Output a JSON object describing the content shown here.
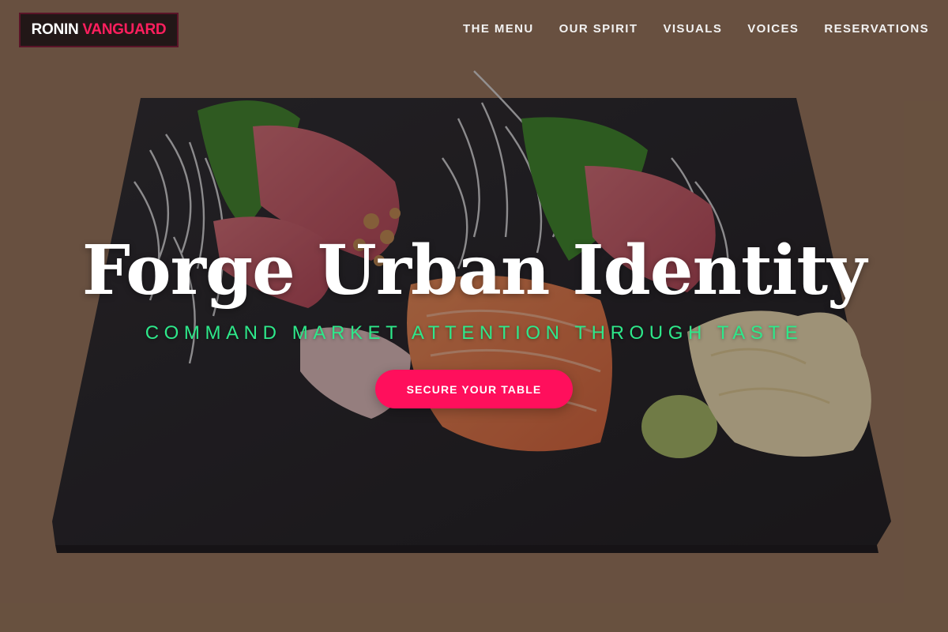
{
  "brand": {
    "name_primary": "RONIN",
    "name_accent": "VANGUARD",
    "accent_color": "#ff1f5e"
  },
  "nav": {
    "items": [
      {
        "label": "THE MENU"
      },
      {
        "label": "OUR SPIRIT"
      },
      {
        "label": "VISUALS"
      },
      {
        "label": "VOICES"
      },
      {
        "label": "RESERVATIONS"
      }
    ]
  },
  "hero": {
    "headline": "Forge Urban Identity",
    "tagline": "COMMAND MARKET ATTENTION THROUGH TASTE",
    "cta_label": "SECURE YOUR TABLE",
    "cta_color": "#ff0f5c",
    "tagline_color": "#2ee88a",
    "image": "sashimi platter on slate board"
  }
}
